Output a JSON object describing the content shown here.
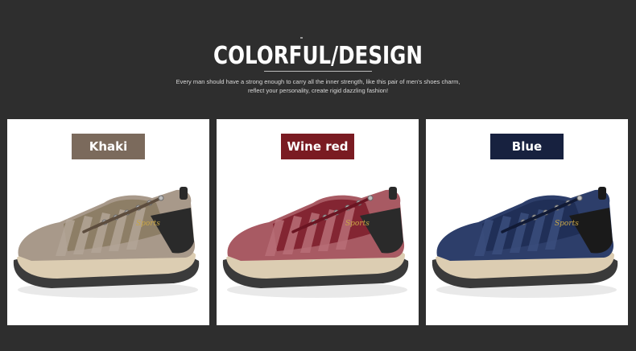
{
  "header": {
    "title": "COLORFUL/DESIGN",
    "subtitle_line1": "Every man should have a strong enough to carry all the inner strength, like this pair of men's shoes charm,",
    "subtitle_line2": "reflect your personality, create rigid dazzling fashion!"
  },
  "products": [
    {
      "label": "Khaki",
      "brand_text": "Sports",
      "colors": {
        "label_bg": "#7b6a5c",
        "upper": "#a8998a",
        "mesh": "#8a7b62",
        "suede": "#b3a596",
        "sole": "#dccdb2",
        "outsole": "#3b3b3b",
        "lace": "#5d4d3e",
        "accent": "#2a2a2a"
      }
    },
    {
      "label": "Wine red",
      "brand_text": "Sports",
      "colors": {
        "label_bg": "#7a1b22",
        "upper": "#a85a63",
        "mesh": "#7e1f2c",
        "suede": "#b86e77",
        "sole": "#dccdb2",
        "outsole": "#3a3a3a",
        "lace": "#6b1522",
        "accent": "#2a2a2a"
      }
    },
    {
      "label": "Blue",
      "brand_text": "Sports",
      "colors": {
        "label_bg": "#17213f",
        "upper": "#2d3e6a",
        "mesh": "#1f2d55",
        "suede": "#3b4d7c",
        "sole": "#dccdb2",
        "outsole": "#3a3a3a",
        "lace": "#111a35",
        "accent": "#1a1a1a"
      }
    }
  ]
}
